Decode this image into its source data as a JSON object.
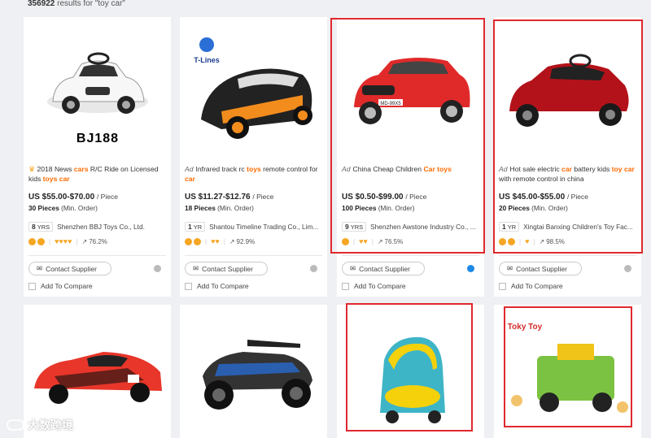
{
  "search": {
    "count": "356922",
    "label": "results for \"toy car\""
  },
  "products": [
    {
      "ad": "",
      "title_parts": [
        "2018 News ",
        "cars",
        " R/C Ride on Licensed kids ",
        "toys car"
      ],
      "price": "US $55.00-$70.00",
      "unit": "/ Piece",
      "moq_qty": "30 Pieces",
      "moq_label": "(Min. Order)",
      "years": "8",
      "years_unit": "YRS",
      "supplier": "Shenzhen BBJ Toys Co., Ltd.",
      "response": "76.2%",
      "img_label": "BJ188",
      "contact": "Contact Supplier",
      "compare": "Add To Compare"
    },
    {
      "ad": "Ad",
      "title_parts": [
        "Infrared track rc ",
        "toys",
        " remote control for ",
        "car"
      ],
      "price": "US $11.27-$12.76",
      "unit": "/ Piece",
      "moq_qty": "18 Pieces",
      "moq_label": "(Min. Order)",
      "years": "1",
      "years_unit": "YR",
      "supplier": "Shantou Timeline Trading Co., Lim...",
      "response": "92.9%",
      "brand": "T-Lines",
      "contact": "Contact Supplier",
      "compare": "Add To Compare"
    },
    {
      "ad": "Ad",
      "title_parts": [
        "China Cheap Children ",
        "Car toys",
        "",
        ""
      ],
      "price": "US $0.50-$99.00",
      "unit": "/ Piece",
      "moq_qty": "100 Pieces",
      "moq_label": "(Min. Order)",
      "years": "9",
      "years_unit": "YRS",
      "supplier": "Shenzhen Awstone Industry Co., ...",
      "response": "76.5%",
      "plate": "MD-99X5",
      "contact": "Contact Supplier",
      "compare": "Add To Compare"
    },
    {
      "ad": "Ad",
      "title_parts": [
        "Hot sale electric ",
        "car",
        " battery kids ",
        "toy car"
      ],
      "title_tail": " with remote control in china",
      "price": "US $45.00-$55.00",
      "unit": "/ Piece",
      "moq_qty": "20 Pieces",
      "moq_label": "(Min. Order)",
      "years": "1",
      "years_unit": "YR",
      "supplier": "Xingtai Banxing Children's Toy Fac...",
      "response": "98.5%",
      "contact": "Contact Supplier",
      "compare": "Add To Compare"
    }
  ],
  "row2": {
    "toy_brand": "Toky Toy"
  },
  "watermark": "大数跨境",
  "colors": {
    "keyword": "#ff6a00",
    "highlight_box": "#e0282e",
    "chat_online": "#1e88e5"
  }
}
